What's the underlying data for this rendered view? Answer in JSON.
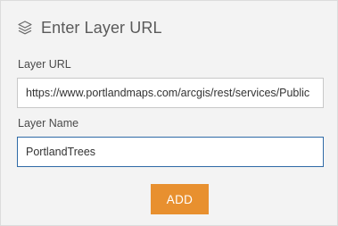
{
  "header": {
    "title": "Enter Layer URL",
    "icon": "layers-icon"
  },
  "form": {
    "url_label": "Layer URL",
    "url_value": "https://www.portlandmaps.com/arcgis/rest/services/Public",
    "name_label": "Layer Name",
    "name_value": "PortlandTrees",
    "add_label": "ADD"
  },
  "colors": {
    "accent": "#e8902f",
    "focus_border": "#2f6aa6",
    "panel_bg": "#f3f3f3"
  }
}
